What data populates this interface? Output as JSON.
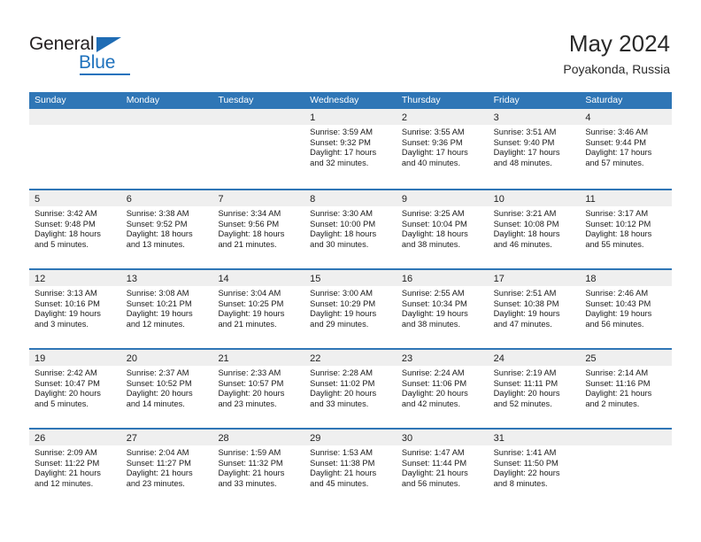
{
  "brand": {
    "name_top": "General",
    "name_bottom": "Blue",
    "triangle_color": "#1f6cb4",
    "blue_color": "#1f72bd"
  },
  "header": {
    "title": "May 2024",
    "location": "Poyakonda, Russia"
  },
  "theme": {
    "header_bar": "#2f76b6",
    "daynum_band": "#efefef",
    "grid_line": "#2f76b6",
    "text": "#1a1a1a"
  },
  "weekday_headers": [
    "Sunday",
    "Monday",
    "Tuesday",
    "Wednesday",
    "Thursday",
    "Friday",
    "Saturday"
  ],
  "weeks": [
    [
      {
        "day": "",
        "lines": []
      },
      {
        "day": "",
        "lines": []
      },
      {
        "day": "",
        "lines": []
      },
      {
        "day": "1",
        "lines": [
          "Sunrise: 3:59 AM",
          "Sunset: 9:32 PM",
          "Daylight: 17 hours",
          "and 32 minutes."
        ]
      },
      {
        "day": "2",
        "lines": [
          "Sunrise: 3:55 AM",
          "Sunset: 9:36 PM",
          "Daylight: 17 hours",
          "and 40 minutes."
        ]
      },
      {
        "day": "3",
        "lines": [
          "Sunrise: 3:51 AM",
          "Sunset: 9:40 PM",
          "Daylight: 17 hours",
          "and 48 minutes."
        ]
      },
      {
        "day": "4",
        "lines": [
          "Sunrise: 3:46 AM",
          "Sunset: 9:44 PM",
          "Daylight: 17 hours",
          "and 57 minutes."
        ]
      }
    ],
    [
      {
        "day": "5",
        "lines": [
          "Sunrise: 3:42 AM",
          "Sunset: 9:48 PM",
          "Daylight: 18 hours",
          "and 5 minutes."
        ]
      },
      {
        "day": "6",
        "lines": [
          "Sunrise: 3:38 AM",
          "Sunset: 9:52 PM",
          "Daylight: 18 hours",
          "and 13 minutes."
        ]
      },
      {
        "day": "7",
        "lines": [
          "Sunrise: 3:34 AM",
          "Sunset: 9:56 PM",
          "Daylight: 18 hours",
          "and 21 minutes."
        ]
      },
      {
        "day": "8",
        "lines": [
          "Sunrise: 3:30 AM",
          "Sunset: 10:00 PM",
          "Daylight: 18 hours",
          "and 30 minutes."
        ]
      },
      {
        "day": "9",
        "lines": [
          "Sunrise: 3:25 AM",
          "Sunset: 10:04 PM",
          "Daylight: 18 hours",
          "and 38 minutes."
        ]
      },
      {
        "day": "10",
        "lines": [
          "Sunrise: 3:21 AM",
          "Sunset: 10:08 PM",
          "Daylight: 18 hours",
          "and 46 minutes."
        ]
      },
      {
        "day": "11",
        "lines": [
          "Sunrise: 3:17 AM",
          "Sunset: 10:12 PM",
          "Daylight: 18 hours",
          "and 55 minutes."
        ]
      }
    ],
    [
      {
        "day": "12",
        "lines": [
          "Sunrise: 3:13 AM",
          "Sunset: 10:16 PM",
          "Daylight: 19 hours",
          "and 3 minutes."
        ]
      },
      {
        "day": "13",
        "lines": [
          "Sunrise: 3:08 AM",
          "Sunset: 10:21 PM",
          "Daylight: 19 hours",
          "and 12 minutes."
        ]
      },
      {
        "day": "14",
        "lines": [
          "Sunrise: 3:04 AM",
          "Sunset: 10:25 PM",
          "Daylight: 19 hours",
          "and 21 minutes."
        ]
      },
      {
        "day": "15",
        "lines": [
          "Sunrise: 3:00 AM",
          "Sunset: 10:29 PM",
          "Daylight: 19 hours",
          "and 29 minutes."
        ]
      },
      {
        "day": "16",
        "lines": [
          "Sunrise: 2:55 AM",
          "Sunset: 10:34 PM",
          "Daylight: 19 hours",
          "and 38 minutes."
        ]
      },
      {
        "day": "17",
        "lines": [
          "Sunrise: 2:51 AM",
          "Sunset: 10:38 PM",
          "Daylight: 19 hours",
          "and 47 minutes."
        ]
      },
      {
        "day": "18",
        "lines": [
          "Sunrise: 2:46 AM",
          "Sunset: 10:43 PM",
          "Daylight: 19 hours",
          "and 56 minutes."
        ]
      }
    ],
    [
      {
        "day": "19",
        "lines": [
          "Sunrise: 2:42 AM",
          "Sunset: 10:47 PM",
          "Daylight: 20 hours",
          "and 5 minutes."
        ]
      },
      {
        "day": "20",
        "lines": [
          "Sunrise: 2:37 AM",
          "Sunset: 10:52 PM",
          "Daylight: 20 hours",
          "and 14 minutes."
        ]
      },
      {
        "day": "21",
        "lines": [
          "Sunrise: 2:33 AM",
          "Sunset: 10:57 PM",
          "Daylight: 20 hours",
          "and 23 minutes."
        ]
      },
      {
        "day": "22",
        "lines": [
          "Sunrise: 2:28 AM",
          "Sunset: 11:02 PM",
          "Daylight: 20 hours",
          "and 33 minutes."
        ]
      },
      {
        "day": "23",
        "lines": [
          "Sunrise: 2:24 AM",
          "Sunset: 11:06 PM",
          "Daylight: 20 hours",
          "and 42 minutes."
        ]
      },
      {
        "day": "24",
        "lines": [
          "Sunrise: 2:19 AM",
          "Sunset: 11:11 PM",
          "Daylight: 20 hours",
          "and 52 minutes."
        ]
      },
      {
        "day": "25",
        "lines": [
          "Sunrise: 2:14 AM",
          "Sunset: 11:16 PM",
          "Daylight: 21 hours",
          "and 2 minutes."
        ]
      }
    ],
    [
      {
        "day": "26",
        "lines": [
          "Sunrise: 2:09 AM",
          "Sunset: 11:22 PM",
          "Daylight: 21 hours",
          "and 12 minutes."
        ]
      },
      {
        "day": "27",
        "lines": [
          "Sunrise: 2:04 AM",
          "Sunset: 11:27 PM",
          "Daylight: 21 hours",
          "and 23 minutes."
        ]
      },
      {
        "day": "28",
        "lines": [
          "Sunrise: 1:59 AM",
          "Sunset: 11:32 PM",
          "Daylight: 21 hours",
          "and 33 minutes."
        ]
      },
      {
        "day": "29",
        "lines": [
          "Sunrise: 1:53 AM",
          "Sunset: 11:38 PM",
          "Daylight: 21 hours",
          "and 45 minutes."
        ]
      },
      {
        "day": "30",
        "lines": [
          "Sunrise: 1:47 AM",
          "Sunset: 11:44 PM",
          "Daylight: 21 hours",
          "and 56 minutes."
        ]
      },
      {
        "day": "31",
        "lines": [
          "Sunrise: 1:41 AM",
          "Sunset: 11:50 PM",
          "Daylight: 22 hours",
          "and 8 minutes."
        ]
      },
      {
        "day": "",
        "lines": []
      }
    ]
  ]
}
